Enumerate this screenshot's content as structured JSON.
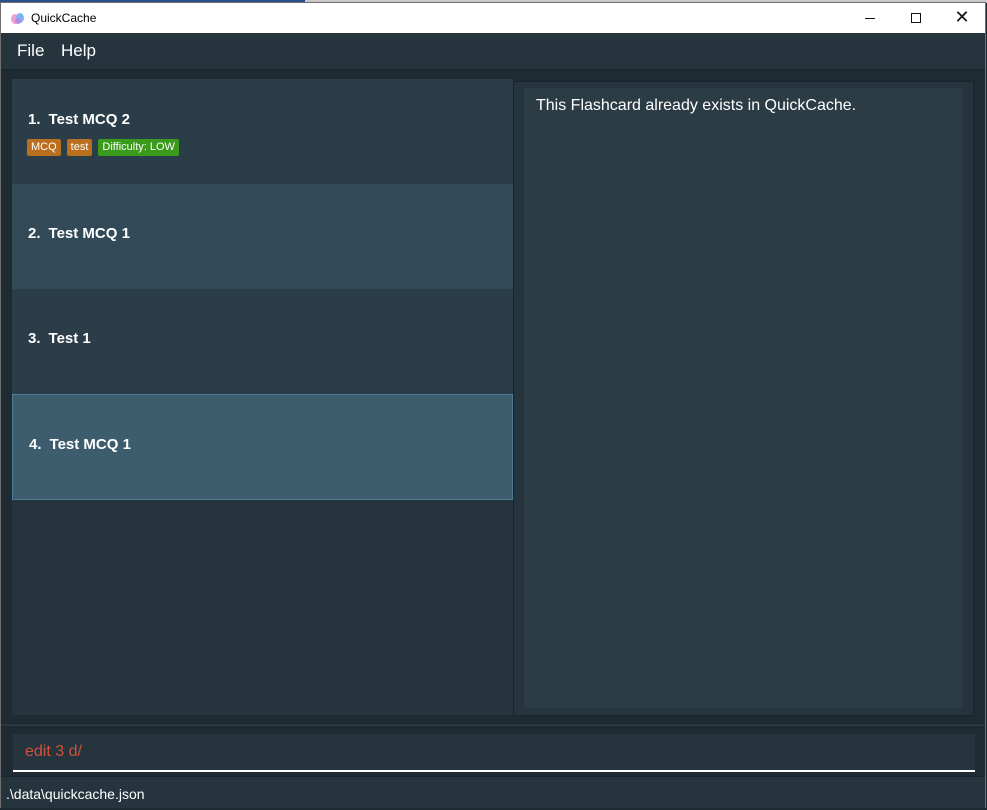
{
  "window": {
    "title": "QuickCache",
    "controls": {
      "minimize_icon": "minimize-icon",
      "maximize_icon": "maximize-icon",
      "close_icon": "close-icon"
    }
  },
  "menu": {
    "file": "File",
    "help": "Help"
  },
  "flashcards": [
    {
      "index": "1.",
      "question": "Test MCQ 2",
      "tags": [
        "MCQ",
        "test"
      ],
      "difficulty": "Difficulty: LOW"
    },
    {
      "index": "2.",
      "question": "Test MCQ 1"
    },
    {
      "index": "3.",
      "question": "Test 1"
    },
    {
      "index": "4.",
      "question": "Test MCQ 1",
      "selected": true
    }
  ],
  "result": {
    "message": "This Flashcard already exists in QuickCache."
  },
  "command": {
    "value": "edit 3 d/"
  },
  "status": {
    "file_path": ".\\data\\quickcache.json"
  },
  "colors": {
    "background": "#25343d",
    "tag_orange": "#b96f1d",
    "tag_green": "#3a9a1c",
    "command_text": "#d0533d",
    "selected_row": "#3d5c6d"
  }
}
